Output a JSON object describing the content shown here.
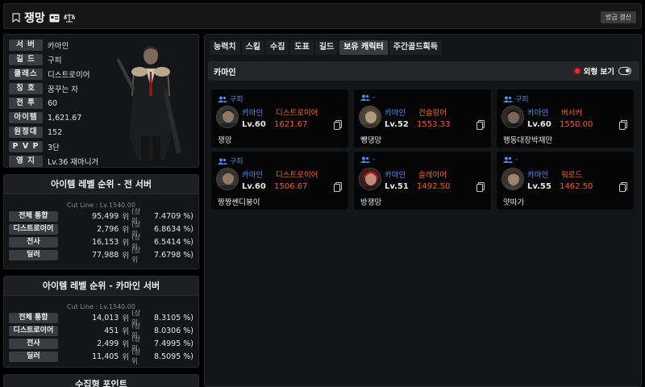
{
  "header": {
    "title": "쟁망",
    "refresh_label": "방금 갱신"
  },
  "profile": {
    "rows": [
      {
        "label": "서 버",
        "value": "카마인"
      },
      {
        "label": "길 드",
        "value": "구피"
      },
      {
        "label": "클래스",
        "value": "디스트로이어"
      },
      {
        "label": "칭 호",
        "value": "꿈꾸는 자"
      },
      {
        "label": "전 투",
        "value": "60"
      },
      {
        "label": "아이템",
        "value": "1,621.67"
      },
      {
        "label": "원정대",
        "value": "152"
      },
      {
        "label": "P V P",
        "value": "3단"
      },
      {
        "label": "영 지",
        "value": "Lv.36 재마니거"
      }
    ]
  },
  "rank_all": {
    "title": "아이템 레벨 순위 - 전 서버",
    "cutline": "Cut Line : Lv.1540.00",
    "rows": [
      {
        "label": "전체 통합",
        "rank": "95,499",
        "unit": "위",
        "up": "(상위",
        "pct": "7.4709 %)"
      },
      {
        "label": "디스트로이어",
        "rank": "2,796",
        "unit": "위",
        "up": "(상위",
        "pct": "6.8634 %)"
      },
      {
        "label": "전사",
        "rank": "16,153",
        "unit": "위",
        "up": "(상위",
        "pct": "6.5414 %)"
      },
      {
        "label": "딜러",
        "rank": "77,988",
        "unit": "위",
        "up": "(상위",
        "pct": "7.6798 %)"
      }
    ]
  },
  "rank_server": {
    "title": "아이템 레벨 순위 - 카마인 서버",
    "cutline": "Cut Line : Lv.1540.00",
    "rows": [
      {
        "label": "전체 통합",
        "rank": "14,013",
        "unit": "위",
        "up": "(상위",
        "pct": "8.3105 %)"
      },
      {
        "label": "디스트로이어",
        "rank": "451",
        "unit": "위",
        "up": "(상위",
        "pct": "8.0306 %)"
      },
      {
        "label": "전사",
        "rank": "2,499",
        "unit": "위",
        "up": "(상위",
        "pct": "7.4995 %)"
      },
      {
        "label": "딜러",
        "rank": "11,405",
        "unit": "위",
        "up": "(상위",
        "pct": "8.5095 %)"
      }
    ]
  },
  "collect_panel": {
    "title": "수집형 포인트"
  },
  "tabs": [
    "능력치",
    "스킬",
    "수집",
    "도표",
    "길드",
    "보유 캐릭터",
    "주간골드획득"
  ],
  "active_tab": "보유 캐릭터",
  "server_section": {
    "name": "카마인",
    "appearance_label": "외형 보기"
  },
  "characters": [
    {
      "guild": "구피",
      "server": "카마인",
      "class": "디스트로이어",
      "level": "Lv.60",
      "item_level": "1621.67",
      "name": "쟁망"
    },
    {
      "guild": "-",
      "server": "카마인",
      "class": "건슬링어",
      "level": "Lv.52",
      "item_level": "1553.33",
      "name": "뺑댕망"
    },
    {
      "guild": "구피",
      "server": "카마인",
      "class": "버서커",
      "level": "Lv.60",
      "item_level": "1550.00",
      "name": "행동대장박재만"
    },
    {
      "guild": "구피",
      "server": "카마인",
      "class": "디스트로이어",
      "level": "Lv.60",
      "item_level": "1506.67",
      "name": "짱짱쎈디붕이"
    },
    {
      "guild": "-",
      "server": "카마인",
      "class": "슬레이어",
      "level": "Lv.51",
      "item_level": "1492.50",
      "name": "방쟁망"
    },
    {
      "guild": "-",
      "server": "카마인",
      "class": "워로드",
      "level": "Lv.55",
      "item_level": "1462.50",
      "name": "얏따가"
    }
  ]
}
